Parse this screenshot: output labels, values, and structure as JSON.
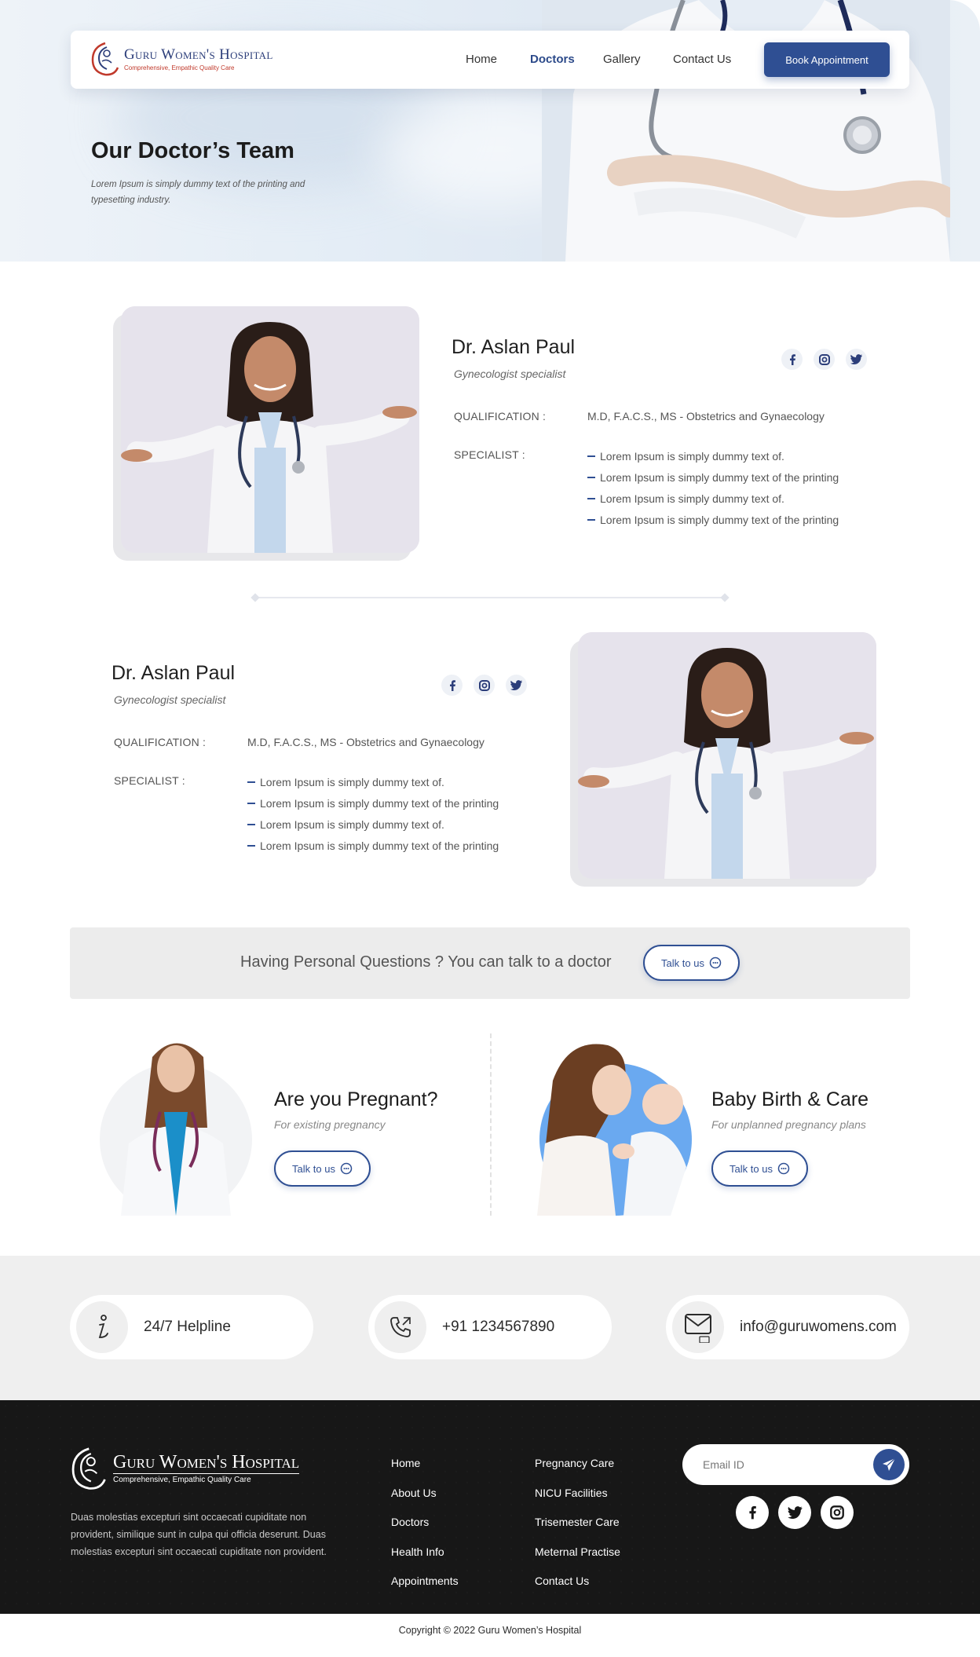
{
  "nav": {
    "logo_name": "Guru Women's Hospital",
    "logo_tagline": "Comprehensive, Empathic Quality Care",
    "links": [
      {
        "label": "Home",
        "active": false
      },
      {
        "label": "Doctors",
        "active": true
      },
      {
        "label": "Gallery",
        "active": false
      },
      {
        "label": "Contact Us",
        "active": false
      }
    ],
    "cta_label": "Book Appointment"
  },
  "hero": {
    "title": "Our Doctor’s Team",
    "subtitle": "Lorem Ipsum is simply dummy text of the printing and typesetting industry."
  },
  "doctors": [
    {
      "name": "Dr. Aslan Paul",
      "role": "Gynecologist specialist",
      "qualification_label": "QUALIFICATION :",
      "qualification": "M.D, F.A.C.S., MS - Obstetrics and Gynaecology",
      "specialist_label": "SPECIALIST :",
      "specialties": [
        "Lorem Ipsum is simply dummy text of.",
        "Lorem Ipsum is simply dummy text of the printing",
        "Lorem Ipsum is simply dummy text of.",
        "Lorem Ipsum is simply dummy text of the printing"
      ]
    },
    {
      "name": "Dr. Aslan Paul",
      "role": "Gynecologist specialist",
      "qualification_label": "QUALIFICATION :",
      "qualification": "M.D, F.A.C.S., MS - Obstetrics and Gynaecology",
      "specialist_label": "SPECIALIST :",
      "specialties": [
        "Lorem Ipsum is simply dummy text of.",
        "Lorem Ipsum is simply dummy text of the printing",
        "Lorem Ipsum is simply dummy text of.",
        "Lorem Ipsum is simply dummy text of the printing"
      ]
    }
  ],
  "cta_banner": {
    "text": "Having Personal Questions ? You can talk to a doctor",
    "button": "Talk to us"
  },
  "promos": [
    {
      "title": "Are you Pregnant?",
      "subtitle": "For existing pregnancy",
      "button": "Talk to us"
    },
    {
      "title": "Baby Birth & Care",
      "subtitle": "For unplanned pregnancy plans",
      "button": "Talk to us"
    }
  ],
  "contacts": [
    {
      "icon": "info-icon",
      "text": "24/7 Helpline"
    },
    {
      "icon": "phone-icon",
      "text": "+91 1234567890"
    },
    {
      "icon": "mail-icon",
      "text": "info@guruwomens.com"
    }
  ],
  "footer": {
    "logo_name": "Guru Women's Hospital",
    "logo_tagline": "Comprehensive, Empathic Quality Care",
    "description": "Duas molestias excepturi sint occaecati cupiditate non provident, similique sunt in culpa qui officia deserunt. Duas molestias excepturi sint occaecati cupiditate non provident.",
    "links_col1": [
      "Home",
      "About Us",
      "Doctors",
      "Health Info",
      "Appointments"
    ],
    "links_col2": [
      "Pregnancy Care",
      "NICU Facilities",
      "Trisemester Care",
      "Meternal Practise",
      "Contact Us"
    ],
    "email_placeholder": "Email ID",
    "copyright": "Copyright © 2022 Guru Women’s Hospital"
  },
  "colors": {
    "primary": "#2f4f93",
    "logo_accent": "#c0392b",
    "footer_bg": "#171717",
    "band_bg": "#efefef"
  }
}
